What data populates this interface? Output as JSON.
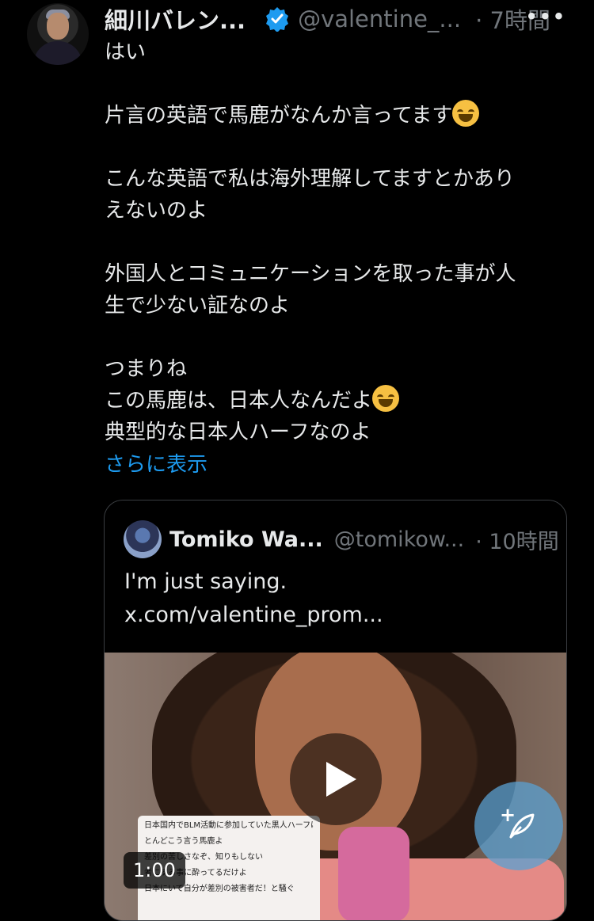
{
  "tweet": {
    "display_name": "細川バレン...",
    "handle": "@valentine_...",
    "time": "· 7時間",
    "more": "•••",
    "lines": [
      "はい",
      "",
      "片言の英語で馬鹿がなんか言ってます",
      "",
      "こんな英語で私は海外理解してますとかあり",
      "えないのよ",
      "",
      "外国人とコミュニケーションを取った事が人",
      "生で少ない証なのよ",
      "",
      "つまりね",
      "この馬鹿は、日本人なんだよ",
      "典型的な日本人ハーフなのよ"
    ],
    "show_more": "さらに表示"
  },
  "quote": {
    "display_name": "Tomiko Wa...",
    "handle": "@tomikow...",
    "time": "· 10時間",
    "text_line1": "I'm just saying.",
    "text_line2": "x.com/valentine_prom...",
    "video": {
      "duration": "1:00",
      "caption_lines": [
        "日本国内でBLM活動に参加していた黒人ハーフは、ほ",
        "とんどこう言う馬鹿よ",
        "差別の苦しさなぞ、知りもしない",
        "者にする事に酔ってるだけよ",
        "日本にいて自分が差別の被害者だ！と騒ぐ"
      ]
    }
  },
  "colors": {
    "accent": "#1d9bf0",
    "secondary_text": "#71767b",
    "background": "#000000"
  },
  "icons": {
    "verified": "verified-badge-icon",
    "compose": "compose-feather-icon",
    "play": "play-icon"
  }
}
